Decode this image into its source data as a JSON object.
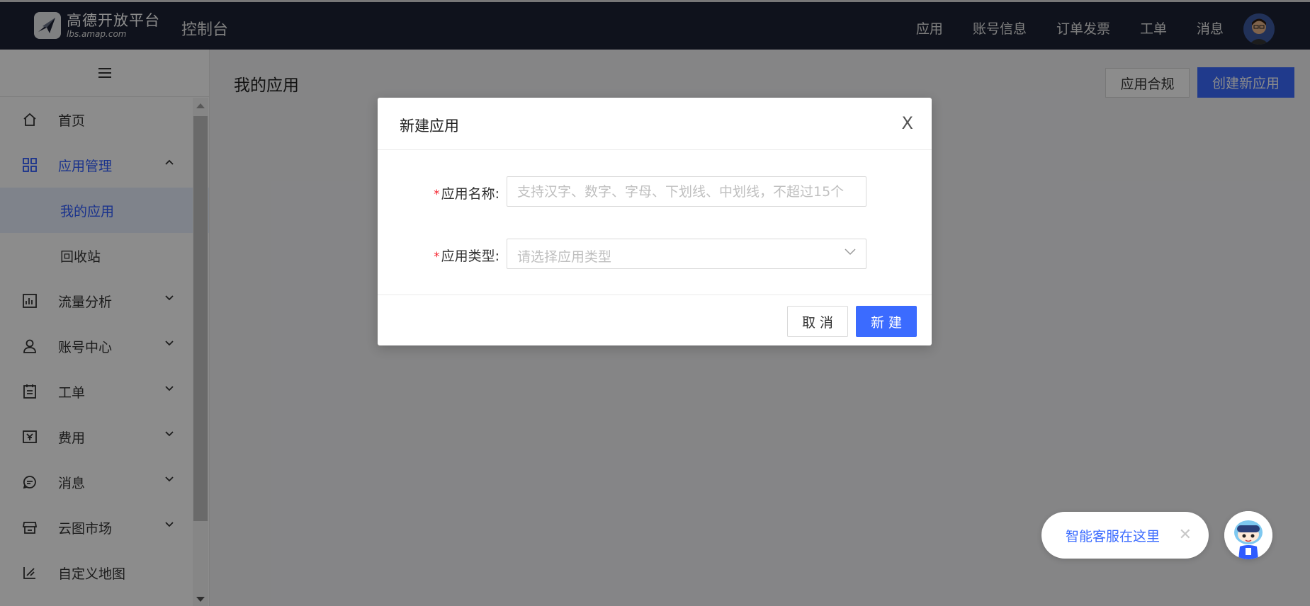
{
  "topbar": {
    "logo_main": "高德开放平台",
    "logo_sub": "lbs.amap.com",
    "console_title": "控制台",
    "nav": [
      "应用",
      "账号信息",
      "订单发票",
      "工单",
      "消息"
    ]
  },
  "sidebar": {
    "items": [
      {
        "label": "首页",
        "icon": "home-icon"
      },
      {
        "label": "应用管理",
        "icon": "grid-icon",
        "expanded": true
      },
      {
        "label": "流量分析",
        "icon": "chart-icon"
      },
      {
        "label": "账号中心",
        "icon": "user-icon"
      },
      {
        "label": "工单",
        "icon": "ticket-icon"
      },
      {
        "label": "费用",
        "icon": "yen-icon"
      },
      {
        "label": "消息",
        "icon": "chat-icon"
      },
      {
        "label": "云图市场",
        "icon": "store-icon"
      },
      {
        "label": "自定义地图",
        "icon": "map-edit-icon"
      }
    ],
    "submenu": [
      "我的应用",
      "回收站"
    ]
  },
  "main": {
    "title": "我的应用",
    "compliance_label": "应用合规",
    "create_label": "创建新应用"
  },
  "dialog": {
    "title": "新建应用",
    "close_label": "X",
    "name_label": "应用名称:",
    "name_placeholder": "支持汉字、数字、字母、下划线、中划线，不超过15个",
    "type_label": "应用类型:",
    "type_placeholder": "请选择应用类型",
    "required_mark": "*",
    "cancel_label": "取 消",
    "submit_label": "新 建"
  },
  "chat": {
    "text": "智能客服在这里",
    "close_label": "✕"
  },
  "colors": {
    "accent": "#3b6bff",
    "topbar": "#1c2233",
    "required": "#f5222d"
  }
}
